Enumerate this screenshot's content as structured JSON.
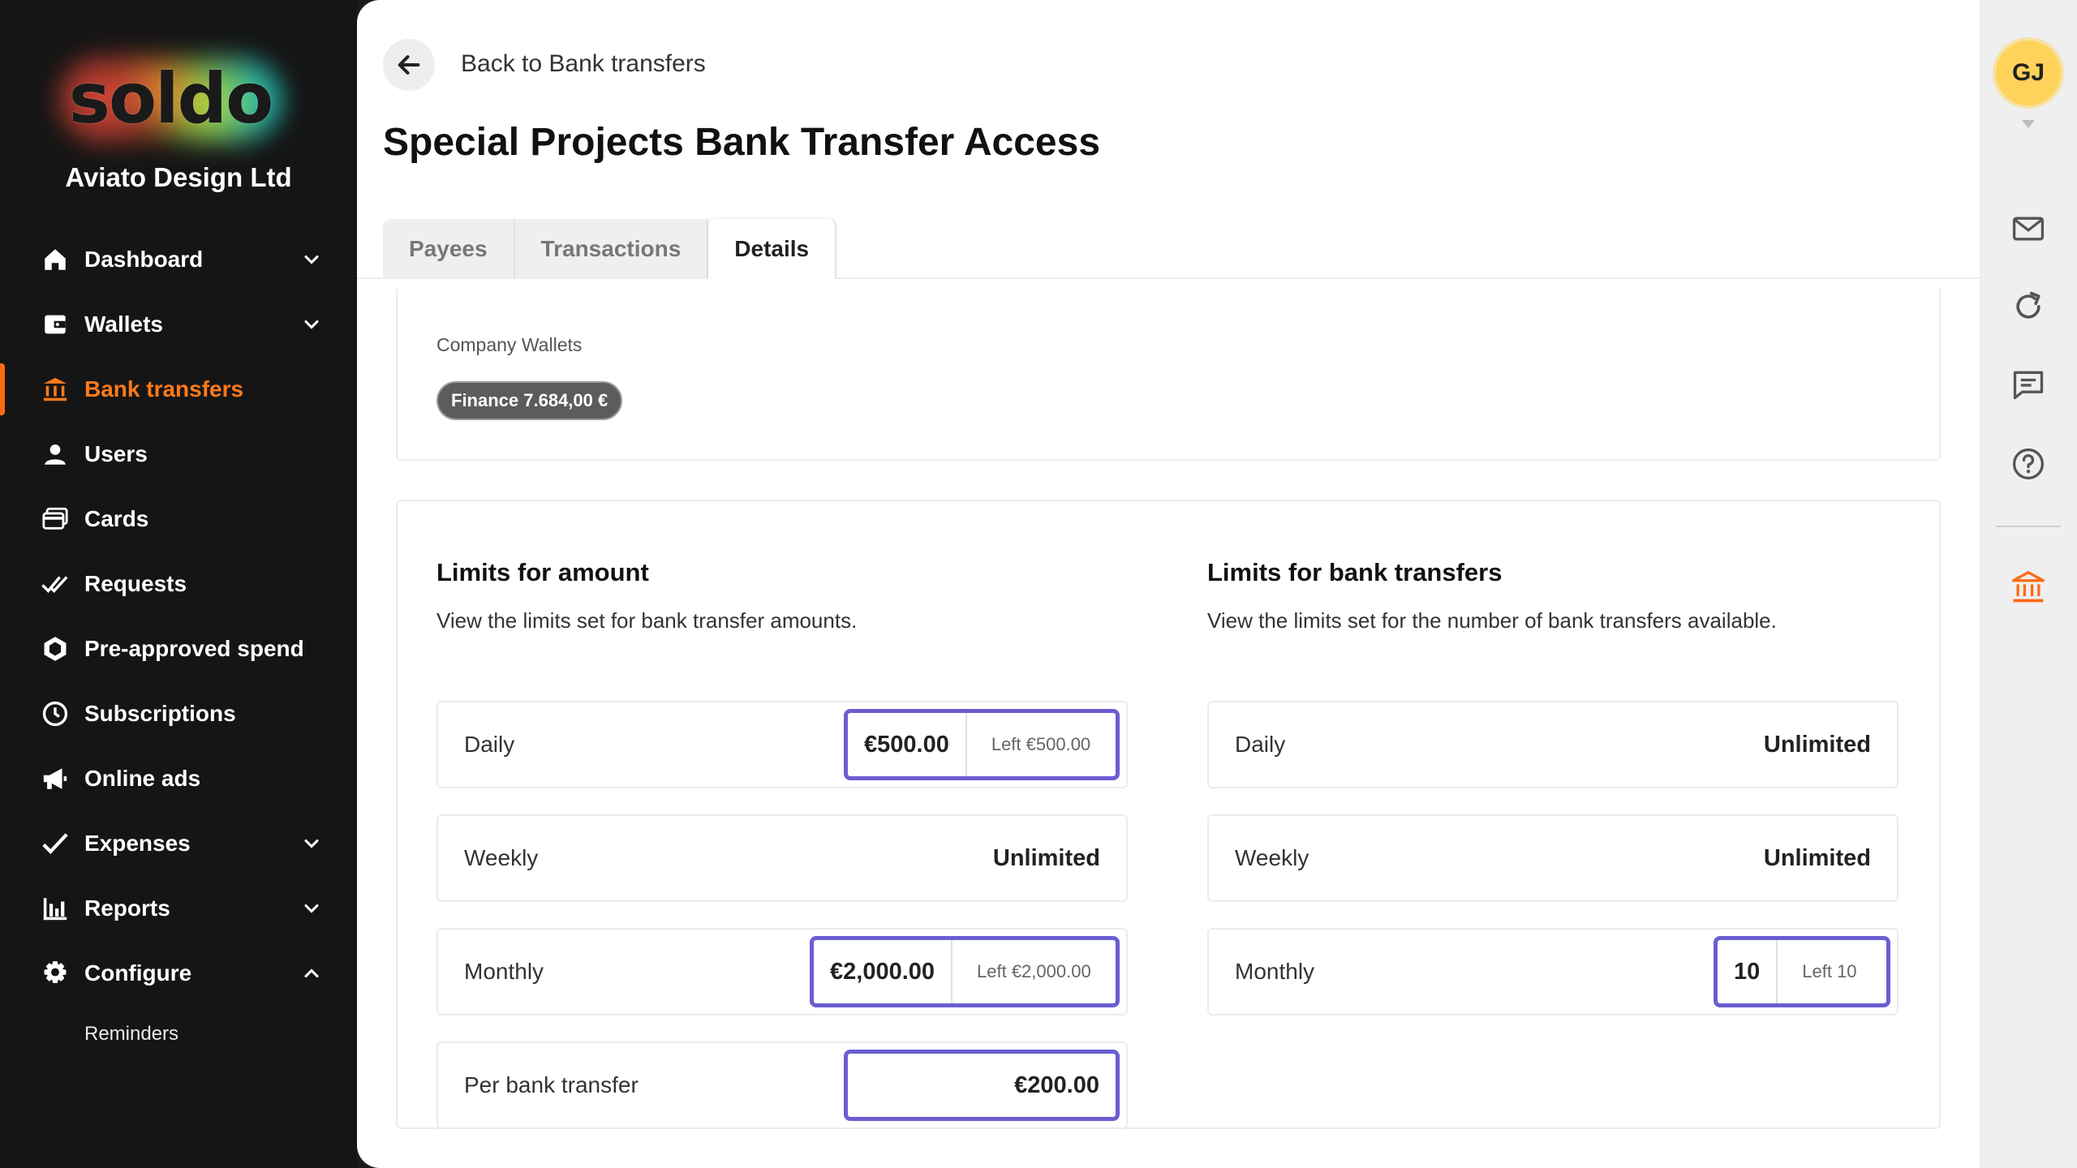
{
  "brand": {
    "logo_text": "soldo",
    "company": "Aviato Design Ltd"
  },
  "nav": {
    "items": [
      {
        "label": "Dashboard",
        "icon": "home-icon",
        "expandable": true
      },
      {
        "label": "Wallets",
        "icon": "wallet-icon",
        "expandable": true
      },
      {
        "label": "Bank transfers",
        "icon": "bank-transfer-icon",
        "active": true
      },
      {
        "label": "Users",
        "icon": "user-icon"
      },
      {
        "label": "Cards",
        "icon": "cards-icon"
      },
      {
        "label": "Requests",
        "icon": "double-check-icon"
      },
      {
        "label": "Pre-approved spend",
        "icon": "hexagon-icon"
      },
      {
        "label": "Subscriptions",
        "icon": "clock-icon"
      },
      {
        "label": "Online ads",
        "icon": "megaphone-icon"
      },
      {
        "label": "Expenses",
        "icon": "checkmark-icon",
        "expandable": true
      },
      {
        "label": "Reports",
        "icon": "bar-chart-icon",
        "expandable": true
      },
      {
        "label": "Configure",
        "icon": "gear-icon",
        "expanded": true
      }
    ],
    "sub_items": [
      {
        "label": "Reminders"
      }
    ],
    "accent_color": "#ff6a13"
  },
  "header": {
    "back_label": "Back to Bank transfers",
    "title": "Special Projects Bank Transfer Access"
  },
  "tabs": [
    {
      "label": "Payees"
    },
    {
      "label": "Transactions"
    },
    {
      "label": "Details",
      "active": true
    }
  ],
  "wallets": {
    "label": "Company Wallets",
    "chip": "Finance 7.684,00 €"
  },
  "limits_amount": {
    "title": "Limits for amount",
    "description": "View the limits set for bank transfer amounts.",
    "rows": [
      {
        "label": "Daily",
        "value": "€500.00",
        "left": "Left €500.00"
      },
      {
        "label": "Weekly",
        "value": "Unlimited"
      },
      {
        "label": "Monthly",
        "value": "€2,000.00",
        "left": "Left €2,000.00"
      },
      {
        "label": "Per bank transfer",
        "value": "€200.00"
      }
    ]
  },
  "limits_transfers": {
    "title": "Limits for bank transfers",
    "description": "View the limits set for the number of bank transfers available.",
    "rows": [
      {
        "label": "Daily",
        "value": "Unlimited"
      },
      {
        "label": "Weekly",
        "value": "Unlimited"
      },
      {
        "label": "Monthly",
        "value": "10",
        "left": "Left 10"
      }
    ]
  },
  "rail": {
    "avatar_initials": "GJ",
    "icons": [
      "mail-icon",
      "refresh-icon",
      "chat-icon",
      "help-icon",
      "bank-icon"
    ],
    "highlight_color": "#6b5dd3"
  }
}
